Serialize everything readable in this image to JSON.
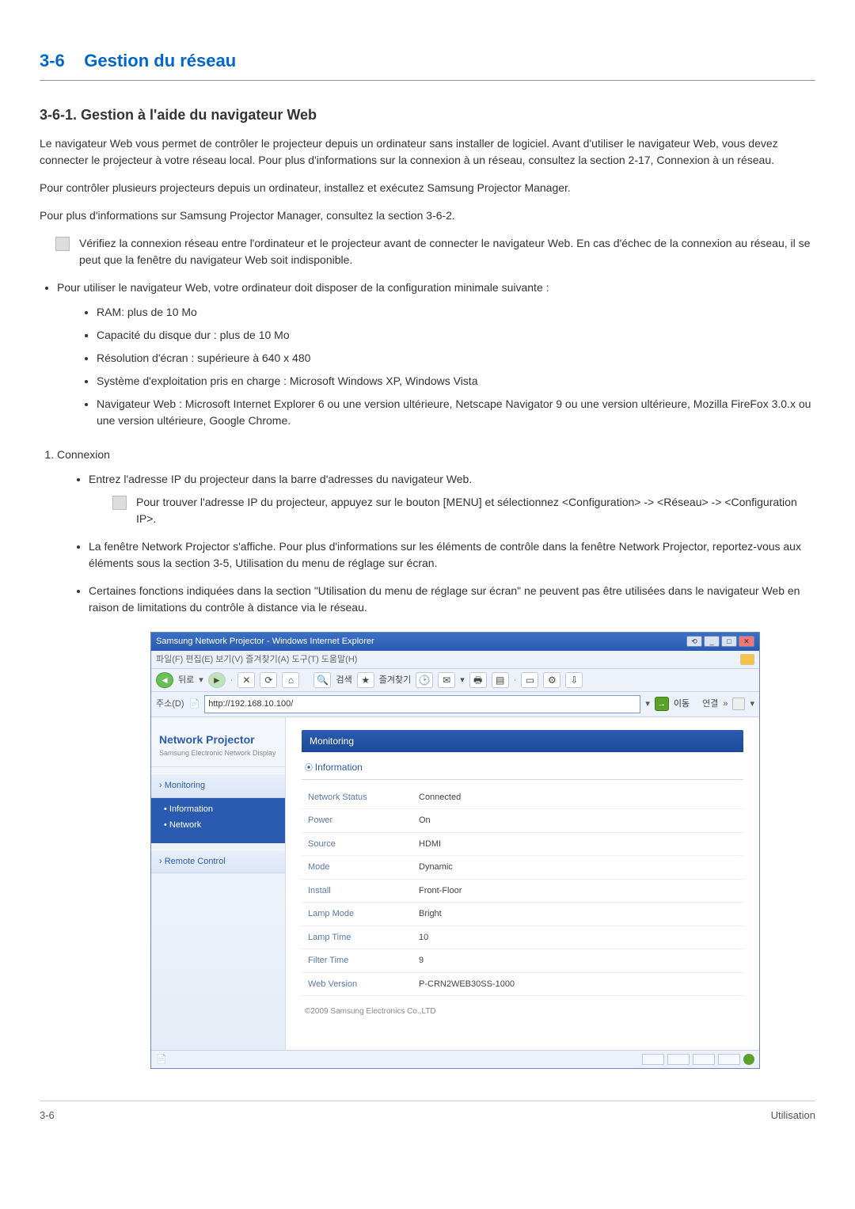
{
  "section": {
    "num": "3-6",
    "title": "Gestion du réseau"
  },
  "subsection": "3-6-1. Gestion à l'aide du navigateur Web",
  "para1": "Le navigateur Web vous permet de contrôler le projecteur depuis un ordinateur sans installer de logiciel. Avant d'utiliser le navigateur Web, vous devez connecter le projecteur à votre réseau local. Pour plus d'informations sur la connexion à un réseau, consultez la section 2-17, Connexion à un réseau.",
  "para2": "Pour contrôler plusieurs projecteurs depuis un ordinateur, installez et exécutez Samsung Projector Manager.",
  "para3": "Pour plus d'informations sur Samsung Projector Manager, consultez la section 3-6-2.",
  "note1": "Vérifiez la connexion réseau entre l'ordinateur et le projecteur avant de connecter le navigateur Web. En cas d'échec de la connexion au réseau, il se peut que la fenêtre du navigateur Web soit indisponible.",
  "reqIntro": "Pour utiliser le navigateur Web, votre ordinateur doit disposer de la configuration minimale suivante :",
  "reqs": {
    "r1": "RAM: plus de 10 Mo",
    "r2": "Capacité du disque dur : plus de 10 Mo",
    "r3": "Résolution d'écran : supérieure à 640 x 480",
    "r4": "Système d'exploitation pris en charge : Microsoft Windows XP, Windows Vista",
    "r5": "Navigateur Web : Microsoft Internet Explorer 6 ou une version ultérieure, Netscape Navigator 9 ou une version ultérieure, Mozilla FireFox 3.0.x ou une version ultérieure, Google Chrome."
  },
  "stepLabel": "Connexion",
  "step1a": "Entrez l'adresse IP du projecteur dans la barre d'adresses du navigateur Web.",
  "step1note": "Pour trouver l'adresse IP du projecteur, appuyez sur le bouton [MENU] et sélectionnez <Configuration> -> <Réseau> -> <Configuration IP>.",
  "step1b": "La fenêtre Network Projector s'affiche. Pour plus d'informations sur les éléments de contrôle dans la fenêtre Network Projector, reportez-vous aux éléments sous la section 3-5, Utilisation du menu de réglage sur écran.",
  "step1c": "Certaines fonctions indiquées dans la section \"Utilisation du menu de réglage sur écran\" ne peuvent pas être utilisées dans le navigateur Web en raison de limitations du contrôle à distance via le réseau.",
  "browser": {
    "title": "Samsung Network Projector - Windows Internet Explorer",
    "menus": "파일(F)  편집(E)  보기(V)  즐겨찾기(A)  도구(T)  도움말(H)",
    "toolbarBack": "뒤로",
    "toolbarSearch": "검색",
    "toolbarFav": "즐겨찾기",
    "addrLabel": "주소(D)",
    "url": "http://192.168.10.100/",
    "goLabel": "이동",
    "linkLabel": "연결",
    "npTitle": "Network Projector",
    "npSub": "Samsung Electronic Network Display",
    "nav": {
      "monitoring": "Monitoring",
      "info": "Information",
      "network": "Network",
      "remote": "Remote Control"
    },
    "panel": {
      "monitoring": "Monitoring",
      "information": "Information"
    },
    "rows": {
      "r1k": "Network Status",
      "r1v": "Connected",
      "r2k": "Power",
      "r2v": "On",
      "r3k": "Source",
      "r3v": "HDMI",
      "r4k": "Mode",
      "r4v": "Dynamic",
      "r5k": "Install",
      "r5v": "Front-Floor",
      "r6k": "Lamp Mode",
      "r6v": "Bright",
      "r7k": "Lamp Time",
      "r7v": "10",
      "r8k": "Filter Time",
      "r8v": "9",
      "r9k": "Web Version",
      "r9v": "P-CRN2WEB30SS-1000"
    },
    "copyright": "©2009 Samsung Electronics Co.,LTD"
  },
  "footer": {
    "left": "3-6",
    "right": "Utilisation"
  }
}
